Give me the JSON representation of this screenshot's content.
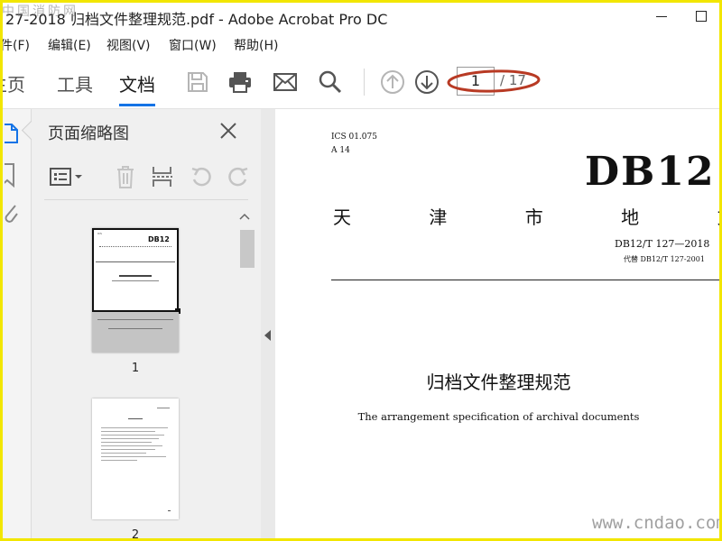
{
  "window": {
    "title": "27-2018 归档文件整理规范.pdf - Adobe Acrobat Pro DC"
  },
  "menubar": {
    "items": [
      "件(F)",
      "编辑(E)",
      "视图(V)",
      "窗口(W)",
      "帮助(H)"
    ]
  },
  "toolbar": {
    "tabs": [
      "主页",
      "工具",
      "文档"
    ],
    "active_tab": "文档",
    "icons": [
      "save-icon",
      "print-icon",
      "email-icon",
      "search-icon",
      "page-up-icon",
      "page-down-icon"
    ],
    "current_page": "1",
    "total_pages": "/ 17"
  },
  "thumbnail_panel": {
    "title": "页面缩略图",
    "tools": [
      "thumbnail-options-icon",
      "delete-icon",
      "extract-icon",
      "rotate-left-icon",
      "rotate-right-icon"
    ],
    "thumbnails": [
      {
        "label": "1",
        "selected": true
      },
      {
        "label": "2",
        "selected": false
      }
    ]
  },
  "document": {
    "ics": "ICS 01.075",
    "class_code": "A 14",
    "standard_prefix": "DB12",
    "standard_type": "天 津 市 地 方 标 准",
    "standard_number": "DB12/T 127—2018",
    "replaces": "代替 DB12/T 127-2001",
    "title_cn": "归档文件整理规范",
    "title_en": "The arrangement specification of archival documents"
  },
  "watermarks": {
    "top_left": "中国消防网",
    "bottom_right": "www.cndao.com"
  },
  "colors": {
    "accent": "#1473e6",
    "annotation": "#c0392b",
    "frame": "#f2e600"
  }
}
